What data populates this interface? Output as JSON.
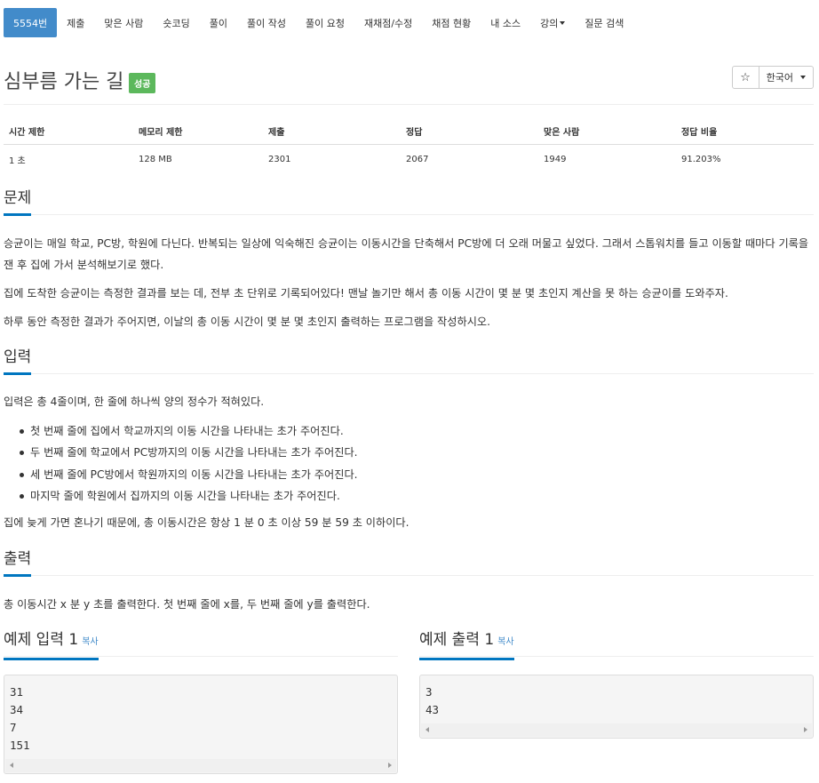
{
  "nav": {
    "items": [
      {
        "label": "5554번",
        "active": true
      },
      {
        "label": "제출"
      },
      {
        "label": "맞은 사람"
      },
      {
        "label": "숏코딩"
      },
      {
        "label": "풀이"
      },
      {
        "label": "풀이 작성"
      },
      {
        "label": "풀이 요청"
      },
      {
        "label": "재채점/수정"
      },
      {
        "label": "채점 현황"
      },
      {
        "label": "내 소스"
      },
      {
        "label": "강의",
        "dropdown": true
      },
      {
        "label": "질문 검색"
      }
    ]
  },
  "problem": {
    "title": "심부름 가는 길",
    "status_badge": "성공",
    "star_icon": "☆",
    "language": "한국어"
  },
  "info_table": {
    "headers": [
      "시간 제한",
      "메모리 제한",
      "제출",
      "정답",
      "맞은 사람",
      "정답 비율"
    ],
    "row": [
      "1 초",
      "128 MB",
      "2301",
      "2067",
      "1949",
      "91.203%"
    ]
  },
  "sections": {
    "description": {
      "heading": "문제",
      "paragraphs": [
        "승균이는 매일 학교, PC방, 학원에 다닌다. 반복되는 일상에 익숙해진 승균이는 이동시간을 단축해서 PC방에 더 오래 머물고 싶었다. 그래서 스톱워치를 들고 이동할 때마다 기록을 잰 후 집에 가서 분석해보기로 했다.",
        "집에 도착한 승균이는 측정한 결과를 보는 데, 전부 초 단위로 기록되어있다! 맨날 놀기만 해서 총 이동 시간이 몇 분 몇 초인지 계산을 못 하는 승균이를 도와주자.",
        "하루 동안 측정한 결과가 주어지면, 이날의 총 이동 시간이 몇 분 몇 초인지 출력하는 프로그램을 작성하시오."
      ]
    },
    "input": {
      "heading": "입력",
      "intro": "입력은 총 4줄이며, 한 줄에 하나씩 양의 정수가 적혀있다.",
      "bullets": [
        "첫 번째 줄에 집에서 학교까지의 이동 시간을 나타내는 초가 주어진다.",
        "두 번째 줄에 학교에서 PC방까지의 이동 시간을 나타내는 초가 주어진다.",
        "세 번째 줄에 PC방에서 학원까지의 이동 시간을 나타내는 초가 주어진다.",
        "마지막 줄에 학원에서 집까지의 이동 시간을 나타내는 초가 주어진다."
      ],
      "outro": "집에 늦게 가면 혼나기 때문에, 총 이동시간은 항상 1 분 0 초 이상 59 분 59 초 이하이다."
    },
    "output": {
      "heading": "출력",
      "text": "총 이동시간 x 분 y 초를 출력한다. 첫 번째 줄에 x를, 두 번째 줄에 y를 출력한다."
    }
  },
  "samples": {
    "input": {
      "heading": "예제 입력 1",
      "copy_label": "복사",
      "lines": [
        "31",
        "34",
        "7",
        "151"
      ]
    },
    "output": {
      "heading": "예제 출력 1",
      "copy_label": "복사",
      "lines": [
        "3",
        "43"
      ]
    }
  }
}
